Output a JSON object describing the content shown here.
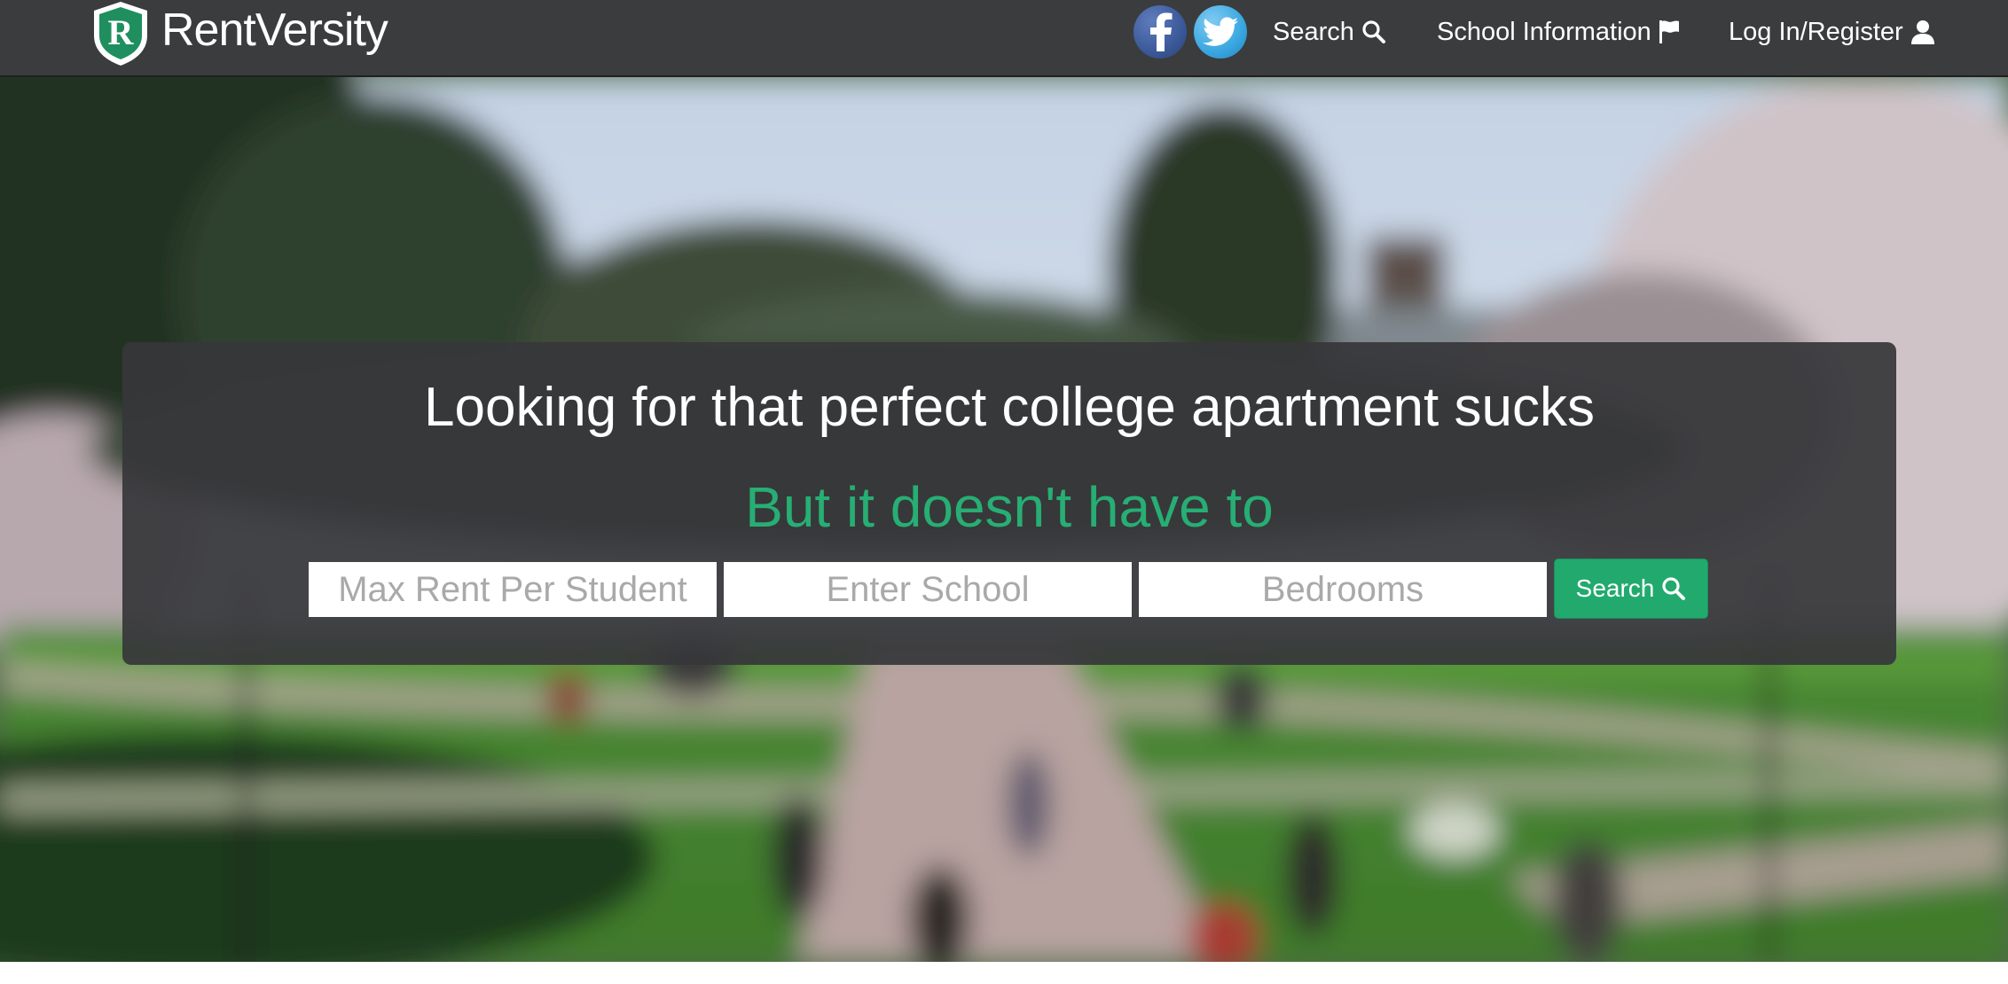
{
  "brand": {
    "logo_letter": "R",
    "name": "RentVersity",
    "colors": {
      "shield": "#1f8f5f",
      "shield_border": "#ffffff"
    }
  },
  "nav": {
    "social": [
      {
        "name": "facebook",
        "icon": "facebook-icon",
        "color": "#3b5998"
      },
      {
        "name": "twitter",
        "icon": "twitter-icon",
        "color": "#3aa7e0"
      }
    ],
    "links": [
      {
        "label": "Search",
        "icon": "search-icon"
      },
      {
        "label": "School Information",
        "icon": "flag-icon"
      },
      {
        "label": "Log In/Register",
        "icon": "user-icon"
      }
    ],
    "background": "#3b3c3e"
  },
  "hero": {
    "headline": "Looking for that perfect college apartment sucks",
    "subheadline": "But it doesn't have to",
    "accent_color": "#27ae74",
    "search_form": {
      "max_rent_placeholder": "Max Rent Per Student",
      "school_placeholder": "Enter School",
      "bedrooms_placeholder": "Bedrooms",
      "button_label": "Search",
      "button_icon": "search-icon",
      "button_color": "#22aa6e"
    }
  }
}
